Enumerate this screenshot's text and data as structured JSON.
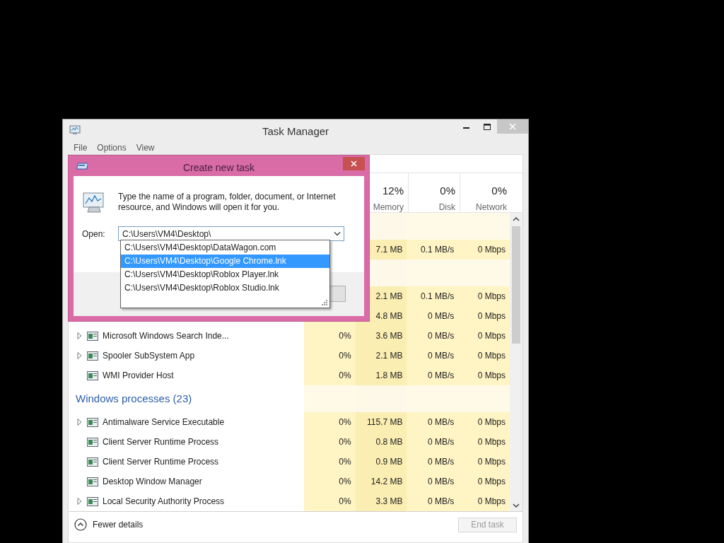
{
  "window": {
    "title": "Task Manager"
  },
  "menu": [
    "File",
    "Options",
    "View"
  ],
  "columns": [
    {
      "label": "Memory",
      "usage": "12%"
    },
    {
      "label": "Disk",
      "usage": "0%"
    },
    {
      "label": "Network",
      "usage": "0%"
    }
  ],
  "processes": [
    {
      "kind": "group"
    },
    {
      "kind": "row",
      "memory": "7.1 MB",
      "disk": "0.1 MB/s",
      "network": "0 Mbps"
    },
    {
      "kind": "group"
    },
    {
      "kind": "row",
      "memory": "2.1 MB",
      "disk": "0.1 MB/s",
      "network": "0 Mbps"
    },
    {
      "kind": "row",
      "memory": "4.8 MB",
      "disk": "0 MB/s",
      "network": "0 Mbps"
    },
    {
      "kind": "row",
      "name": "Microsoft Windows Search Inde...",
      "expandable": true,
      "cpu": "0%",
      "memory": "3.6 MB",
      "disk": "0 MB/s",
      "network": "0 Mbps"
    },
    {
      "kind": "row",
      "name": "Spooler SubSystem App",
      "expandable": true,
      "cpu": "0%",
      "memory": "2.1 MB",
      "disk": "0 MB/s",
      "network": "0 Mbps"
    },
    {
      "kind": "row",
      "name": "WMI Provider Host",
      "expandable": false,
      "cpu": "0%",
      "memory": "1.8 MB",
      "disk": "0 MB/s",
      "network": "0 Mbps"
    },
    {
      "kind": "group",
      "label": "Windows processes (23)"
    },
    {
      "kind": "row",
      "name": "Antimalware Service Executable",
      "expandable": true,
      "cpu": "0%",
      "memory": "115.7 MB",
      "disk": "0 MB/s",
      "network": "0 Mbps"
    },
    {
      "kind": "row",
      "name": "Client Server Runtime Process",
      "expandable": false,
      "cpu": "0%",
      "memory": "0.8 MB",
      "disk": "0 MB/s",
      "network": "0 Mbps"
    },
    {
      "kind": "row",
      "name": "Client Server Runtime Process",
      "expandable": false,
      "cpu": "0%",
      "memory": "0.9 MB",
      "disk": "0 MB/s",
      "network": "0 Mbps"
    },
    {
      "kind": "row",
      "name": "Desktop Window Manager",
      "expandable": false,
      "cpu": "0%",
      "memory": "14.2 MB",
      "disk": "0 MB/s",
      "network": "0 Mbps"
    },
    {
      "kind": "row",
      "name": "Local Security Authority Process",
      "expandable": true,
      "cpu": "0%",
      "memory": "3.3 MB",
      "disk": "0 MB/s",
      "network": "0 Mbps"
    }
  ],
  "footer": {
    "fewer_details": "Fewer details",
    "end_task": {
      "label": "End task",
      "disabled": true
    }
  },
  "dialog": {
    "title": "Create new task",
    "message": "Type the name of a program, folder, document, or Internet resource, and Windows will open it for you.",
    "open_label": "Open:",
    "value": "C:\\Users\\VM4\\Desktop\\",
    "suggestions": [
      {
        "text": "C:\\Users\\VM4\\Desktop\\DataWagon.com",
        "selected": false
      },
      {
        "text": "C:\\Users\\VM4\\Desktop\\Google Chrome.lnk",
        "selected": true
      },
      {
        "text": "C:\\Users\\VM4\\Desktop\\Roblox Player.lnk",
        "selected": false
      },
      {
        "text": "C:\\Users\\VM4\\Desktop\\Roblox Studio.lnk",
        "selected": false
      }
    ]
  }
}
